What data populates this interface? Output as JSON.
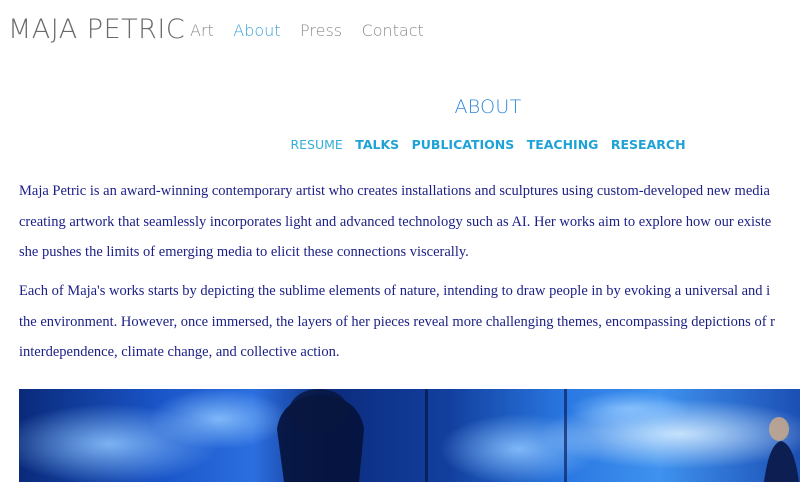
{
  "site": {
    "brand": "MAJA PETRIC",
    "nav": [
      {
        "label": "Art",
        "active": false
      },
      {
        "label": "About",
        "active": true
      },
      {
        "label": "Press",
        "active": false
      },
      {
        "label": "Contact",
        "active": false
      }
    ]
  },
  "page": {
    "title": "ABOUT",
    "subnav": [
      {
        "label": "RESUME",
        "active": true
      },
      {
        "label": "TALKS",
        "active": false
      },
      {
        "label": "PUBLICATIONS",
        "active": false
      },
      {
        "label": "TEACHING",
        "active": false
      },
      {
        "label": "RESEARCH",
        "active": false
      }
    ],
    "paragraph1": [
      "Maja Petric is an award-winning contemporary artist who creates installations and sculptures using custom-developed new media",
      "creating artwork that seamlessly incorporates light and advanced technology such as AI. Her works aim to explore how our existe",
      "she pushes the limits of emerging media to elicit these connections viscerally."
    ],
    "paragraph2": [
      "Each of Maja's works starts by depicting the sublime elements of nature, intending to draw people in by evoking a universal and i",
      "the environment. However, once immersed, the layers of her pieces reveal more challenging themes, encompassing depictions of r",
      "interdependence, climate change, and collective action."
    ]
  },
  "colors": {
    "brand_text": "#6b6b6b",
    "nav_active": "#3aa0dc",
    "body_text": "#1b1f85",
    "subnav": "#1fa3d6"
  }
}
